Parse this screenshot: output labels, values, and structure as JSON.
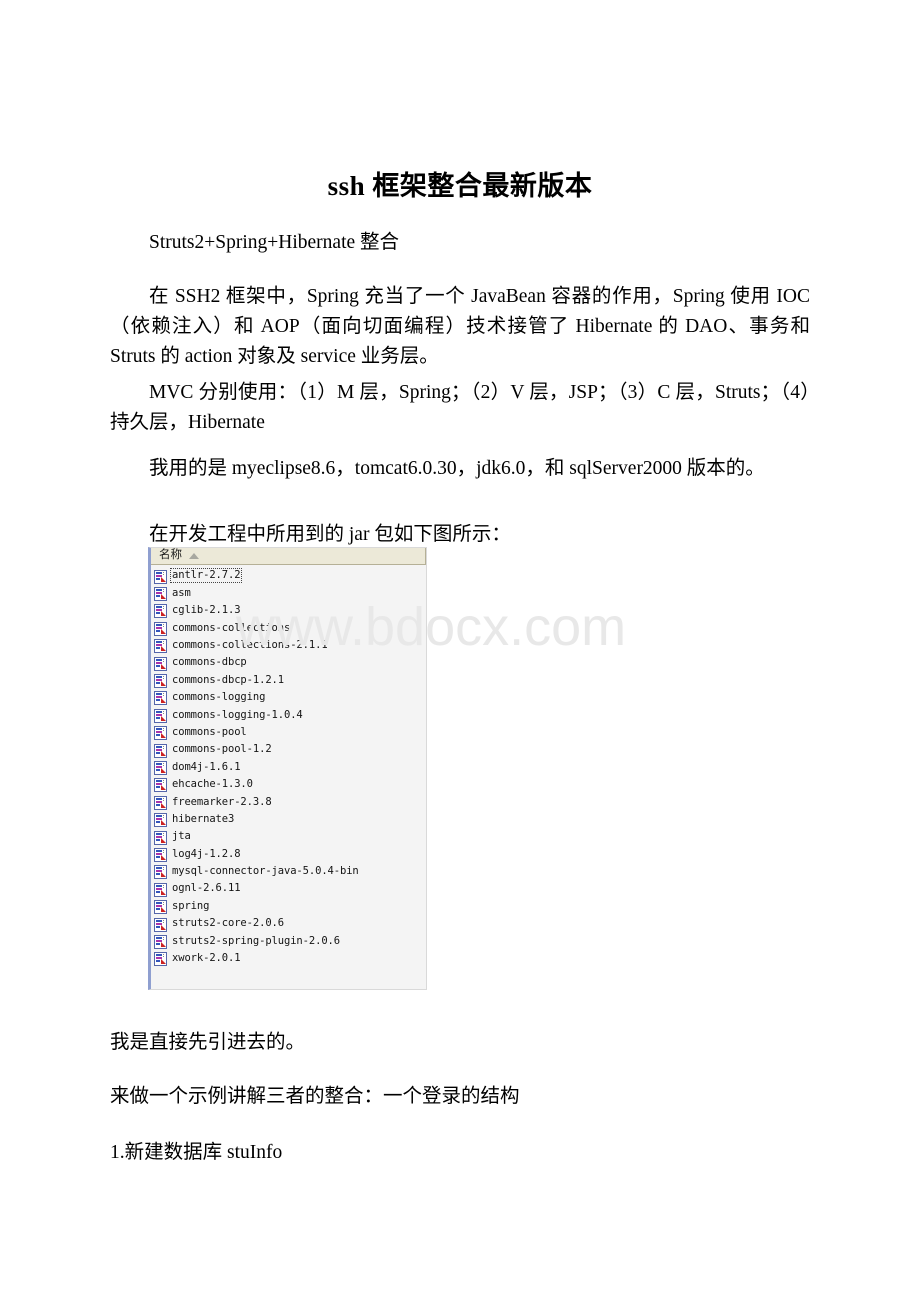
{
  "document": {
    "title": "ssh 框架整合最新版本",
    "paragraphs": {
      "struts_line": "Struts2+Spring+Hibernate 整合",
      "ssh2_desc": "在 SSH2 框架中，Spring 充当了一个 JavaBean 容器的作用，Spring 使用 IOC（依赖注入）和 AOP（面向切面编程）技术接管了 Hibernate 的 DAO、事务和 Struts 的 action 对象及 service 业务层。",
      "mvc_desc": "MVC 分别使用：（1）M 层，Spring；（2）V 层，JSP；（3）C 层，Struts；（4）持久层，Hibernate",
      "versions": "我用的是 myeclipse8.6，tomcat6.0.30，jdk6.0，和 sqlServer2000 版本的。",
      "jar_intro": "在开发工程中所用到的 jar 包如下图所示：",
      "import_note": "我是直接先引进去的。",
      "example_intro": "来做一个示例讲解三者的整合：一个登录的结构",
      "step_one": "1.新建数据库 stuInfo"
    }
  },
  "watermark": {
    "text": "www.bdocx.com",
    "color": "#e8e8e8"
  },
  "explorer": {
    "column_header": "名称",
    "sort_icon": "sort-ascending-icon",
    "file_icon_name": "jar-archive-icon",
    "files": [
      {
        "name": "antlr-2.7.2",
        "focused": true
      },
      {
        "name": "asm",
        "focused": false
      },
      {
        "name": "cglib-2.1.3",
        "focused": false
      },
      {
        "name": "commons-collections",
        "focused": false
      },
      {
        "name": "commons-collections-2.1.1",
        "focused": false
      },
      {
        "name": "commons-dbcp",
        "focused": false
      },
      {
        "name": "commons-dbcp-1.2.1",
        "focused": false
      },
      {
        "name": "commons-logging",
        "focused": false
      },
      {
        "name": "commons-logging-1.0.4",
        "focused": false
      },
      {
        "name": "commons-pool",
        "focused": false
      },
      {
        "name": "commons-pool-1.2",
        "focused": false
      },
      {
        "name": "dom4j-1.6.1",
        "focused": false
      },
      {
        "name": "ehcache-1.3.0",
        "focused": false
      },
      {
        "name": "freemarker-2.3.8",
        "focused": false
      },
      {
        "name": "hibernate3",
        "focused": false
      },
      {
        "name": "jta",
        "focused": false
      },
      {
        "name": "log4j-1.2.8",
        "focused": false
      },
      {
        "name": "mysql-connector-java-5.0.4-bin",
        "focused": false
      },
      {
        "name": "ognl-2.6.11",
        "focused": false
      },
      {
        "name": "spring",
        "focused": false
      },
      {
        "name": "struts2-core-2.0.6",
        "focused": false
      },
      {
        "name": "struts2-spring-plugin-2.0.6",
        "focused": false
      },
      {
        "name": "xwork-2.0.1",
        "focused": false
      }
    ]
  }
}
